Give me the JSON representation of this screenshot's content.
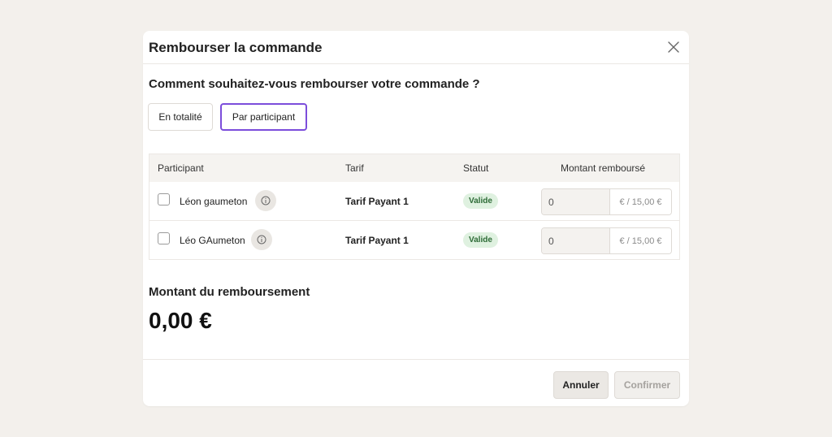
{
  "modal": {
    "title": "Rembourser la commande",
    "question": "Comment souhaitez-vous rembourser votre commande ?",
    "options": [
      {
        "label": "En totalité",
        "selected": false
      },
      {
        "label": "Par participant",
        "selected": true
      }
    ]
  },
  "table": {
    "headers": {
      "participant": "Participant",
      "tarif": "Tarif",
      "statut": "Statut",
      "montant": "Montant remboursé"
    },
    "rows": [
      {
        "name": "Léon gaumeton",
        "tarif": "Tarif Payant 1",
        "statut": "Valide",
        "amount": "0",
        "suffix": "€ / 15,00 €",
        "checked": false
      },
      {
        "name": "Léo GAumeton",
        "tarif": "Tarif Payant 1",
        "statut": "Valide",
        "amount": "0",
        "suffix": "€ / 15,00 €",
        "checked": false
      }
    ]
  },
  "refund": {
    "label": "Montant du remboursement",
    "value": "0,00 €"
  },
  "footer": {
    "cancel_label": "Annuler",
    "confirm_label": "Confirmer"
  },
  "icons": {
    "close": "close-icon",
    "info": "info-icon"
  },
  "colors": {
    "accent": "#7c4ddb",
    "badge_bg": "#dff1e0",
    "badge_text": "#2d6b36"
  }
}
